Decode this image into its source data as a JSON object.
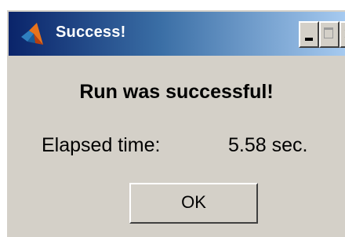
{
  "window": {
    "title": "Success!",
    "icon": "matlab-logo-icon",
    "controls": {
      "minimize_icon": "minimize-icon",
      "maximize_icon": "maximize-icon",
      "close_glyph": "×"
    }
  },
  "dialog": {
    "message": "Run was successful!",
    "elapsed_label": "Elapsed time:",
    "elapsed_value": "5.58 sec.",
    "ok_label": "OK"
  },
  "colors": {
    "titlebar_start": "#0a246a",
    "titlebar_end": "#a6caf0",
    "dialog_background": "#d4d0c8"
  }
}
